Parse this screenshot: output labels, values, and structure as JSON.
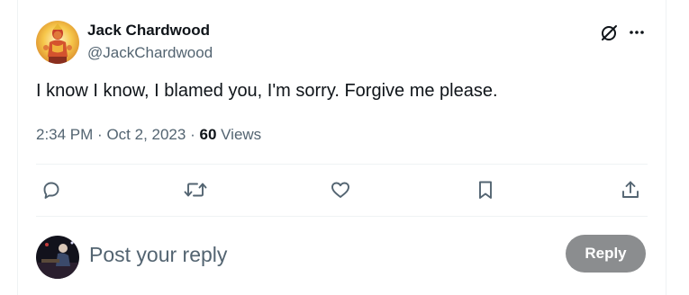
{
  "author": {
    "name": "Jack Chardwood",
    "handle": "@JackChardwood",
    "avatar_icon": "hanuman-avatar-icon"
  },
  "tweet": {
    "text": "I know I know, I blamed you, I'm sorry. Forgive me please.",
    "time": "2:34 PM",
    "separator": "·",
    "date": "Oct 2, 2023",
    "views_count": "60",
    "views_label": "Views"
  },
  "header_icons": [
    "grok-icon",
    "more-icon"
  ],
  "actions": [
    {
      "name": "reply",
      "icon": "comment-icon"
    },
    {
      "name": "retweet",
      "icon": "retweet-icon"
    },
    {
      "name": "like",
      "icon": "heart-icon"
    },
    {
      "name": "bookmark",
      "icon": "bookmark-icon"
    },
    {
      "name": "share",
      "icon": "share-icon"
    }
  ],
  "reply_composer": {
    "placeholder": "Post your reply",
    "button_label": "Reply",
    "avatar_icon": "user-avatar-icon"
  },
  "colors": {
    "text_primary": "#0f1419",
    "text_secondary": "#536471",
    "divider": "#eff3f4",
    "reply_button_disabled": "#8b8d8f"
  }
}
